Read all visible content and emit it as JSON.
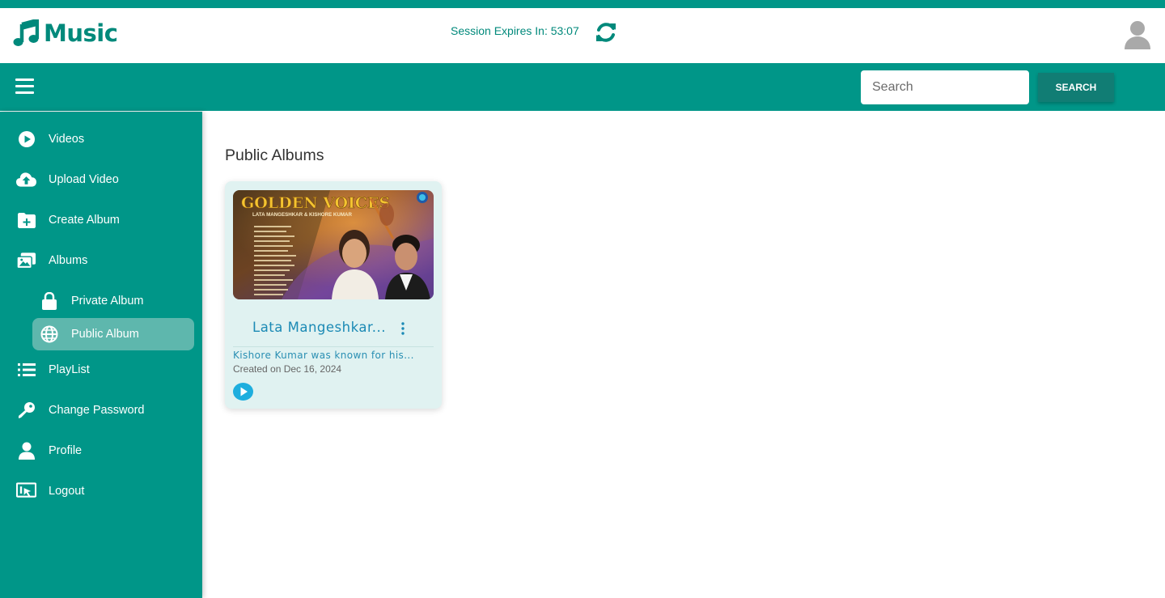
{
  "app": {
    "title": "Music",
    "brand_color": "#009688",
    "logo_icon": "music-note-icon"
  },
  "header": {
    "session_text": "Session Expires In: 53:07",
    "refresh_icon": "refresh-icon",
    "avatar_icon": "user-avatar-icon"
  },
  "toolbar": {
    "menu_icon": "hamburger-menu-icon",
    "search_placeholder": "Search",
    "search_value": "",
    "search_button": "SEARCH"
  },
  "sidebar": {
    "items": [
      {
        "label": "Videos",
        "icon": "play-circle-icon"
      },
      {
        "label": "Upload Video",
        "icon": "cloud-upload-icon"
      },
      {
        "label": "Create Album",
        "icon": "folder-plus-icon"
      },
      {
        "label": "Albums",
        "icon": "images-icon"
      },
      {
        "label": "PlayList",
        "icon": "list-icon"
      },
      {
        "label": "Change Password",
        "icon": "key-icon"
      },
      {
        "label": "Profile",
        "icon": "user-icon"
      },
      {
        "label": "Logout",
        "icon": "logout-icon"
      }
    ],
    "sub_items": [
      {
        "label": "Private Album",
        "icon": "lock-icon",
        "active": false
      },
      {
        "label": "Public Album",
        "icon": "globe-icon",
        "active": true
      }
    ]
  },
  "main": {
    "title": "Public Albums",
    "albums": [
      {
        "cover_heading": "GOLDEN VOICES",
        "cover_subheading": "LATA MANGESHKAR & KISHORE KUMAR",
        "title": "Lata Mangeshkar...",
        "description": "Kishore Kumar was known for his...",
        "created": "Created on Dec 16, 2024",
        "menu_icon": "kebab-menu-icon",
        "play_icon": "play-icon"
      }
    ]
  }
}
